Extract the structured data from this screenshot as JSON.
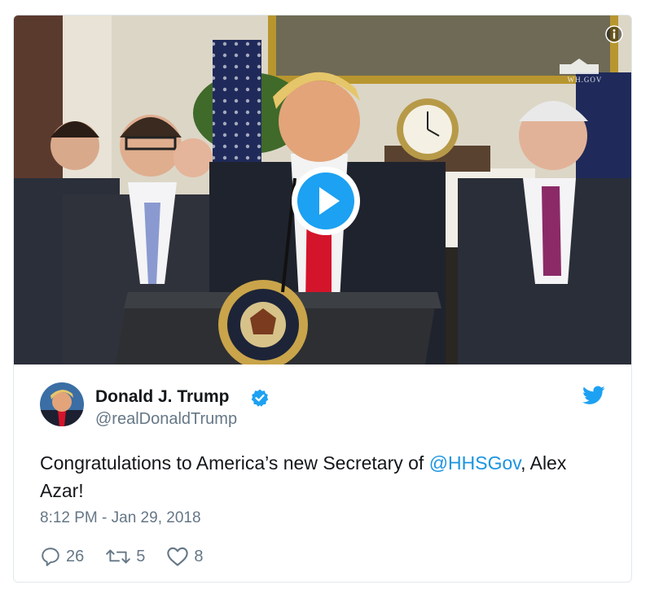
{
  "media": {
    "watermark_text": "WH.GOV",
    "seal_text": "SEAL OF THE PRESIDENT OF THE UNITED STATES",
    "has_video": true
  },
  "tweet": {
    "display_name": "Donald J. Trump",
    "handle": "@realDonaldTrump",
    "verified": true,
    "text_before": "Congratulations to America’s new Secretary of ",
    "mention": "@HHSGov",
    "text_after": ", Alex Azar!",
    "timestamp": "8:12 PM - Jan 29, 2018"
  },
  "actions": {
    "replies": "26",
    "retweets": "5",
    "likes": "8"
  },
  "colors": {
    "accent": "#1da1f2",
    "mention": "#1b95e0",
    "secondary_text": "#657786",
    "border": "#e1e8ed",
    "tie_red": "#d4142a"
  },
  "icons": [
    "info-icon",
    "play-icon",
    "verified-badge-icon",
    "twitter-bird-icon",
    "reply-icon",
    "retweet-icon",
    "like-icon"
  ]
}
